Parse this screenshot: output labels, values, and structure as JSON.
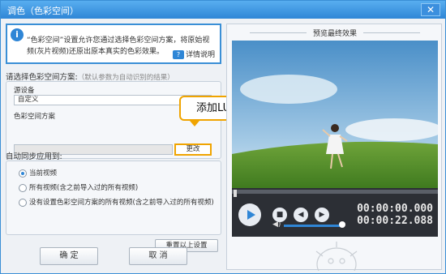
{
  "window": {
    "title": "调色（色彩空间）",
    "close_glyph": "✕"
  },
  "info": {
    "icon": "i",
    "text": "“色彩空间”设置允许您通过选择色彩空间方案，将原始视频(灰片视频)还原出原本真实的色彩效果。",
    "detail_icon": "?",
    "detail_link": "详情说明"
  },
  "scheme": {
    "title": "请选择色彩空间方案:",
    "hint": "（默认参数为自动识别的结果）",
    "source_label": "源设备",
    "source_value": "自定义",
    "colorspace_label": "色彩空间方案",
    "colorspace_value": "",
    "change_button": "更改",
    "callout": "添加LUT文件"
  },
  "sync": {
    "title": "自动同步应用到:",
    "options": [
      {
        "label": "当前视频",
        "checked": true
      },
      {
        "label": "所有视频(含之前导入过的所有视频)",
        "checked": false
      },
      {
        "label": "没有设置色彩空间方案的所有视频(含之前导入过的所有视频)",
        "checked": false
      }
    ],
    "reset_button": "重置以上设置"
  },
  "buttons": {
    "ok": "确 定",
    "cancel": "取 消"
  },
  "preview": {
    "title": "预览最终效果",
    "current_time": "00:00:00.000",
    "total_time": "00:00:22.088",
    "progress": 0.0,
    "volume": 0.9,
    "stop_glyph": "■",
    "prev_glyph": "◀",
    "next_glyph": "▶",
    "volume_glyph": "◀)"
  },
  "colors": {
    "accent": "#2f86d6",
    "highlight": "#f0a400",
    "player_bg": "#2c2f35"
  }
}
